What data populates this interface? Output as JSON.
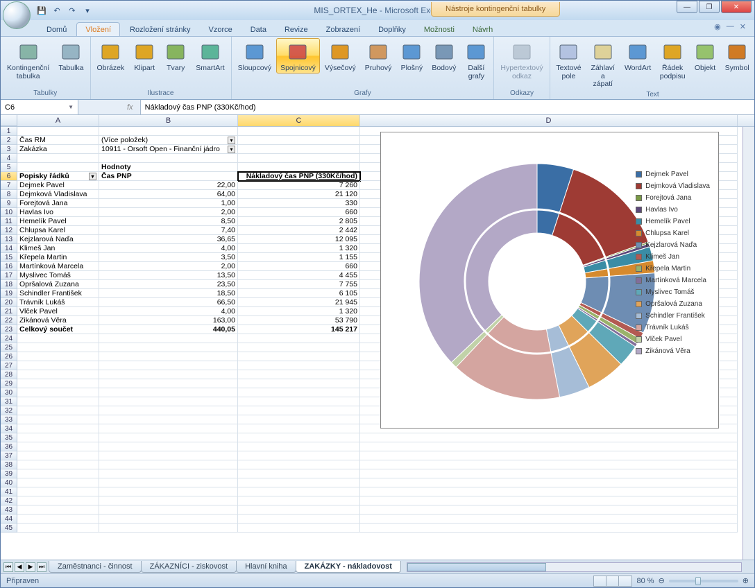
{
  "titlebar": {
    "document": "MIS_ORTEX_He",
    "app": "Microsoft Excel",
    "context_tools": "Nástroje kontingenční tabulky"
  },
  "ribbon": {
    "tabs": [
      "Domů",
      "Vložení",
      "Rozložení stránky",
      "Vzorce",
      "Data",
      "Revize",
      "Zobrazení",
      "Doplňky",
      "Možnosti",
      "Návrh"
    ],
    "active_tab": 1,
    "groups": {
      "tabulky": {
        "label": "Tabulky",
        "items": [
          "Kontingenční\ntabulka",
          "Tabulka"
        ]
      },
      "ilustrace": {
        "label": "Ilustrace",
        "items": [
          "Obrázek",
          "Klipart",
          "Tvary",
          "SmartArt"
        ]
      },
      "grafy": {
        "label": "Grafy",
        "items": [
          "Sloupcový",
          "Spojnicový",
          "Výsečový",
          "Pruhový",
          "Plošný",
          "Bodový",
          "Další\ngrafy"
        ]
      },
      "odkazy": {
        "label": "Odkazy",
        "items": [
          "Hypertextový\nodkaz"
        ]
      },
      "text": {
        "label": "Text",
        "items": [
          "Textové\npole",
          "Záhlaví\na zápatí",
          "WordArt",
          "Řádek\npodpisu",
          "Objekt",
          "Symbol"
        ]
      }
    }
  },
  "formula": {
    "cell_ref": "C6",
    "fx": "fx",
    "value": "Nákladový čas PNP (330Kč/hod)"
  },
  "columns": {
    "A": 118,
    "B": 200,
    "C": 176,
    "D": 544
  },
  "pivot": {
    "filter1": {
      "label": "Čas RM",
      "value": "(Více položek)"
    },
    "filter2": {
      "label": "Zakázka",
      "value": "10911 - Orsoft Open - Finanční jádro"
    },
    "values_header": "Hodnoty",
    "row_header": "Popisky řádků",
    "col1": "Čas PNP",
    "col2": "Nákladový čas PNP (330Kč/hod)",
    "rows": [
      {
        "n": "Dejmek Pavel",
        "a": "22,00",
        "b": "7 260"
      },
      {
        "n": "Dejmková Vladislava",
        "a": "64,00",
        "b": "21 120"
      },
      {
        "n": "Forejtová Jana",
        "a": "1,00",
        "b": "330"
      },
      {
        "n": "Havlas Ivo",
        "a": "2,00",
        "b": "660"
      },
      {
        "n": "Hemelík Pavel",
        "a": "8,50",
        "b": "2 805"
      },
      {
        "n": "Chlupsa Karel",
        "a": "7,40",
        "b": "2 442"
      },
      {
        "n": "Kejzlarová Naďa",
        "a": "36,65",
        "b": "12 095"
      },
      {
        "n": "Klimeš Jan",
        "a": "4,00",
        "b": "1 320"
      },
      {
        "n": "Křepela Martin",
        "a": "3,50",
        "b": "1 155"
      },
      {
        "n": "Martínková Marcela",
        "a": "2,00",
        "b": "660"
      },
      {
        "n": "Myslivec Tomáš",
        "a": "13,50",
        "b": "4 455"
      },
      {
        "n": "Opršalová Zuzana",
        "a": "23,50",
        "b": "7 755"
      },
      {
        "n": "Schindler František",
        "a": "18,50",
        "b": "6 105"
      },
      {
        "n": "Trávník Lukáš",
        "a": "66,50",
        "b": "21 945"
      },
      {
        "n": "Vlček Pavel",
        "a": "4,00",
        "b": "1 320"
      },
      {
        "n": "Zikánová Věra",
        "a": "163,00",
        "b": "53 790"
      }
    ],
    "total": {
      "label": "Celkový součet",
      "a": "440,05",
      "b": "145 217"
    }
  },
  "chart_data": {
    "type": "pie",
    "title": "",
    "series": [
      {
        "name": "Dejmek Pavel",
        "value": 22.0,
        "color": "#3a6ea5"
      },
      {
        "name": "Dejmková Vladislava",
        "value": 64.0,
        "color": "#9e3b34"
      },
      {
        "name": "Forejtová Jana",
        "value": 1.0,
        "color": "#7a9a46"
      },
      {
        "name": "Havlas Ivo",
        "value": 2.0,
        "color": "#5d497a"
      },
      {
        "name": "Hemelík Pavel",
        "value": 8.5,
        "color": "#3a8ca5"
      },
      {
        "name": "Chlupsa Karel",
        "value": 7.4,
        "color": "#d68a2e"
      },
      {
        "name": "Kejzlarová Naďa",
        "value": 36.65,
        "color": "#6e8db3"
      },
      {
        "name": "Klimeš Jan",
        "value": 4.0,
        "color": "#b35a52"
      },
      {
        "name": "Křepela Martin",
        "value": 3.5,
        "color": "#9ab26a"
      },
      {
        "name": "Martínková Marcela",
        "value": 2.0,
        "color": "#826e9a"
      },
      {
        "name": "Myslivec Tomáš",
        "value": 13.5,
        "color": "#5fa8b8"
      },
      {
        "name": "Opršalová Zuzana",
        "value": 23.5,
        "color": "#e0a45a"
      },
      {
        "name": "Schindler František",
        "value": 18.5,
        "color": "#a6bdd7"
      },
      {
        "name": "Trávník Lukáš",
        "value": 66.5,
        "color": "#d4a5a0"
      },
      {
        "name": "Vlček Pavel",
        "value": 4.0,
        "color": "#c1d2a8"
      },
      {
        "name": "Zikánová Věra",
        "value": 163.0,
        "color": "#b3a8c6"
      }
    ]
  },
  "sheet_tabs": [
    "Zaměstnanci - činnost",
    "ZÁKAZNÍCI - ziskovost",
    "Hlavní kniha",
    "ZAKÁZKY - nákladovost"
  ],
  "active_sheet": 3,
  "status": {
    "ready": "Připraven",
    "zoom": "80 %"
  }
}
